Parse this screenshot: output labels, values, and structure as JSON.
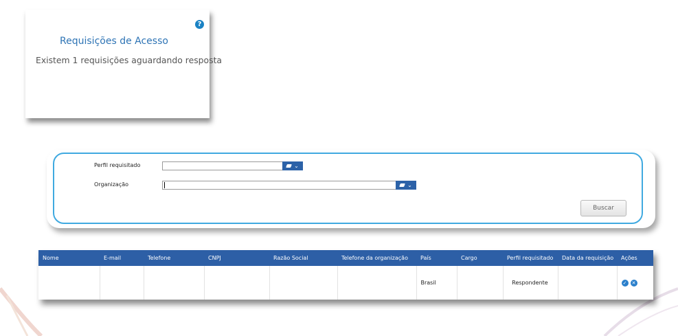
{
  "widget": {
    "title": "Requisições de Acesso",
    "message": "Existem 1 requisições aguardando resposta",
    "help_icon": "?"
  },
  "filter": {
    "perfil_label": "Perfil requisitado",
    "perfil_value": "",
    "organizacao_label": "Organização",
    "organizacao_value": "",
    "buscar_label": "Buscar"
  },
  "table": {
    "columns": [
      "Nome",
      "E-mail",
      "Telefone",
      "CNPJ",
      "Razão Social",
      "Telefone da organização",
      "País",
      "Cargo",
      "Perfil requisitado",
      "Data da requisição",
      "Ações"
    ],
    "rows": [
      {
        "nome": "",
        "email": "",
        "telefone": "",
        "cnpj": "",
        "razao_social": "",
        "telefone_org": "",
        "pais": "Brasil",
        "cargo": "",
        "perfil": "Respondente",
        "data": ""
      }
    ]
  },
  "colors": {
    "accent": "#2e74b5",
    "header": "#2d5fa6",
    "panel_border": "#3fa9e0"
  }
}
